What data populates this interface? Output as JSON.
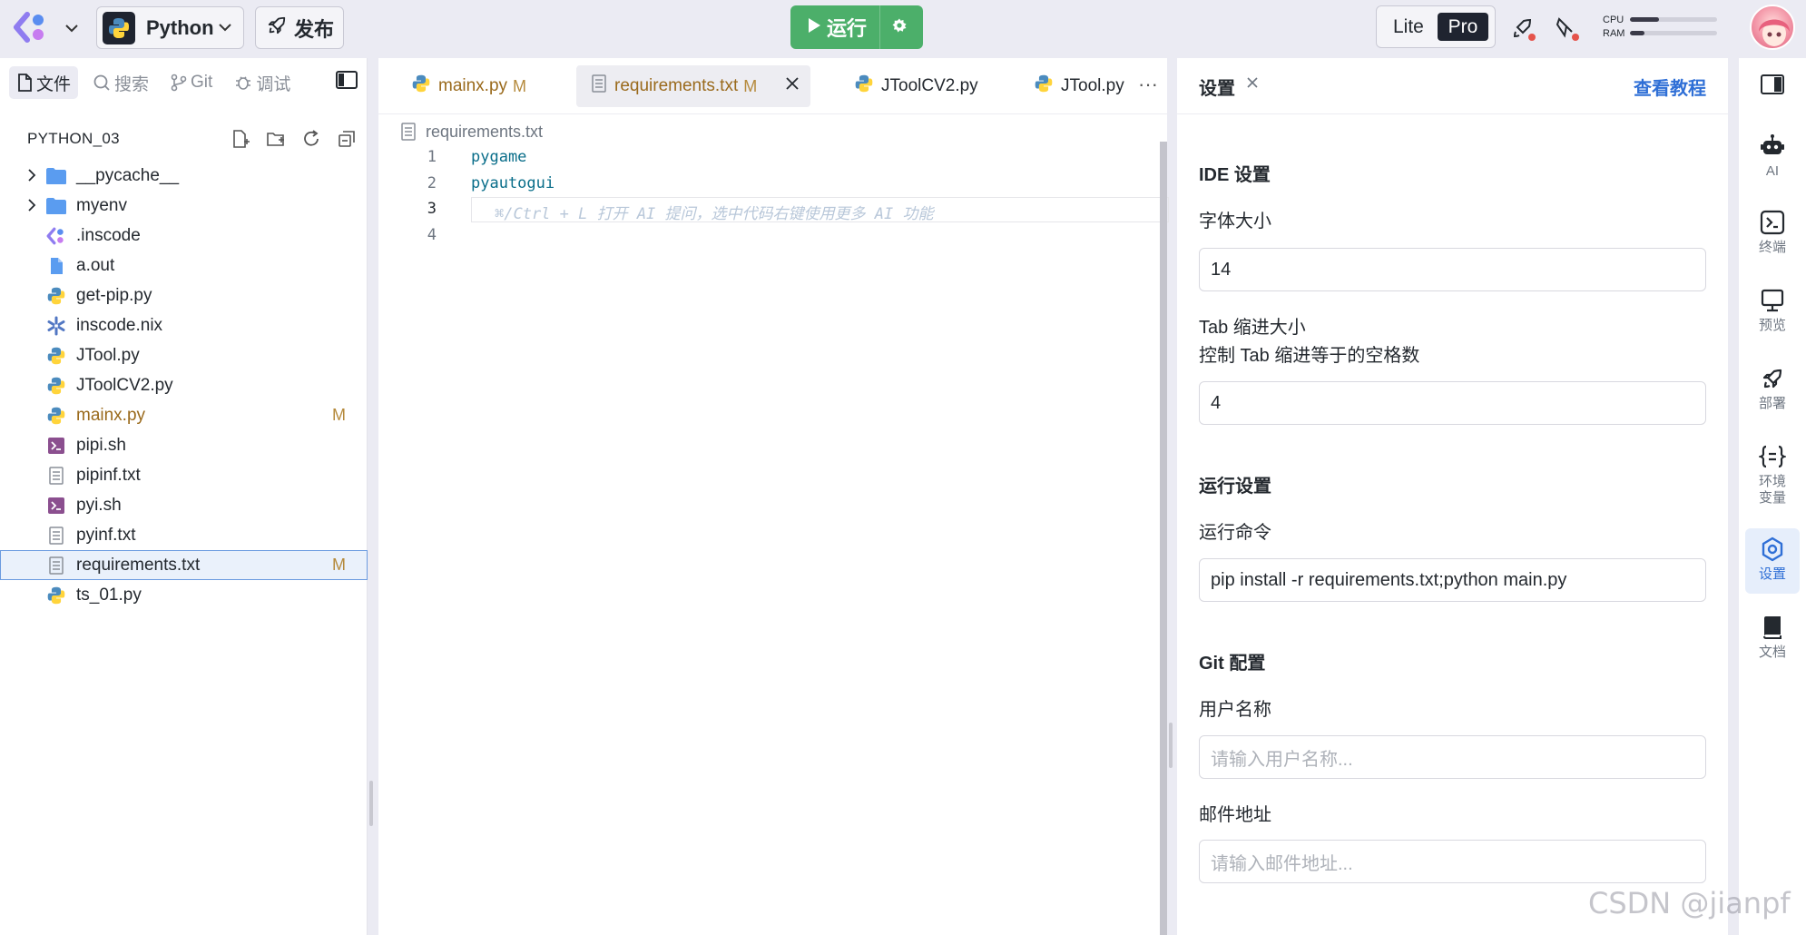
{
  "topbar": {
    "language": "Python",
    "publish_label": "发布",
    "run_label": "运行",
    "mode_lite": "Lite",
    "mode_pro": "Pro",
    "cpu_label": "CPU",
    "ram_label": "RAM",
    "cpu_usage": 0.33,
    "ram_usage": 0.17
  },
  "sidebar": {
    "tabs": [
      {
        "label": "文件",
        "icon": "file-icon"
      },
      {
        "label": "搜索",
        "icon": "search-icon"
      },
      {
        "label": "Git",
        "icon": "git-icon"
      },
      {
        "label": "调试",
        "icon": "bug-icon"
      }
    ],
    "project_name": "PYTHON_03",
    "files": [
      {
        "name": "__pycache__",
        "type": "folder",
        "badge": ""
      },
      {
        "name": "myenv",
        "type": "folder",
        "badge": ""
      },
      {
        "name": ".inscode",
        "type": "inscode",
        "badge": ""
      },
      {
        "name": "a.out",
        "type": "file",
        "badge": ""
      },
      {
        "name": "get-pip.py",
        "type": "python",
        "badge": ""
      },
      {
        "name": "inscode.nix",
        "type": "nix",
        "badge": ""
      },
      {
        "name": "JTool.py",
        "type": "python",
        "badge": ""
      },
      {
        "name": "JToolCV2.py",
        "type": "python",
        "badge": ""
      },
      {
        "name": "mainx.py",
        "type": "python",
        "badge": "M"
      },
      {
        "name": "pipi.sh",
        "type": "shell",
        "badge": ""
      },
      {
        "name": "pipinf.txt",
        "type": "text",
        "badge": ""
      },
      {
        "name": "pyi.sh",
        "type": "shell",
        "badge": ""
      },
      {
        "name": "pyinf.txt",
        "type": "text",
        "badge": ""
      },
      {
        "name": "requirements.txt",
        "type": "text",
        "badge": "M"
      },
      {
        "name": "ts_01.py",
        "type": "python",
        "badge": ""
      }
    ]
  },
  "editor": {
    "tabs": [
      {
        "name": "mainx.py",
        "badge": "M"
      },
      {
        "name": "requirements.txt",
        "badge": "M"
      },
      {
        "name": "JToolCV2.py",
        "badge": ""
      },
      {
        "name": "JTool.py",
        "badge": ""
      }
    ],
    "more": "···",
    "breadcrumb": "requirements.txt",
    "lines": [
      {
        "num": "1",
        "text": "pygame"
      },
      {
        "num": "2",
        "text": "pyautogui"
      },
      {
        "num": "3",
        "text": ""
      },
      {
        "num": "4",
        "text": ""
      }
    ],
    "hint": "⌘/Ctrl + L 打开 AI 提问，选中代码右键使用更多 AI 功能"
  },
  "settings": {
    "title": "设置",
    "tutorial": "查看教程",
    "ide_section": "IDE 设置",
    "font_size_label": "字体大小",
    "font_size_value": "14",
    "tab_size_label": "Tab 缩进大小",
    "tab_size_desc": "控制 Tab 缩进等于的空格数",
    "tab_size_value": "4",
    "run_section": "运行设置",
    "run_cmd_label": "运行命令",
    "run_cmd_value": "pip install -r requirements.txt;python main.py",
    "git_section": "Git 配置",
    "username_label": "用户名称",
    "username_placeholder": "请输入用户名称...",
    "email_label": "邮件地址",
    "email_placeholder": "请输入邮件地址..."
  },
  "activity": [
    {
      "label": "AI",
      "icon": "robot-icon"
    },
    {
      "label": "终端",
      "icon": "terminal-icon"
    },
    {
      "label": "预览",
      "icon": "monitor-icon"
    },
    {
      "label": "部署",
      "icon": "rocket-icon"
    },
    {
      "label": "环境\n变量",
      "icon": "braces-icon"
    },
    {
      "label": "设置",
      "icon": "settings-icon"
    },
    {
      "label": "文档",
      "icon": "book-icon"
    }
  ],
  "watermark": "CSDN @jianpf",
  "colors": {
    "run": "#4caf6a",
    "accent": "#2f6fd6",
    "modified": "#b58a3c"
  }
}
